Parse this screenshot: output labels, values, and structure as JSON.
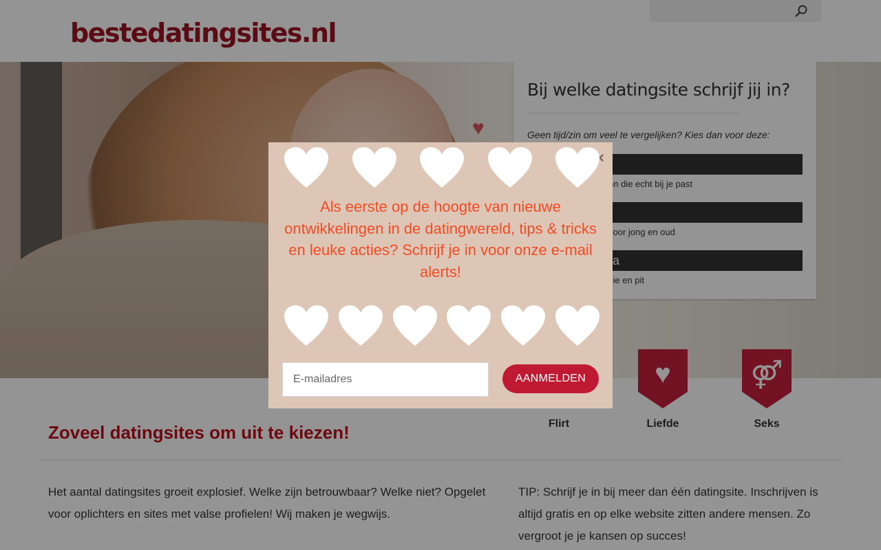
{
  "header": {
    "logo_text": "bestedatingsites.nl",
    "search_icon": "search-icon"
  },
  "panel": {
    "title": "Bij welke datingsite schrijf jij in?",
    "intro": "Geen tijd/zin om veel te vergelijken? Kies dan voor deze:",
    "sites": [
      {
        "name": "",
        "description": "on die echt bij je past"
      },
      {
        "name": "",
        "description": "voor jong en oud"
      },
      {
        "name": "ra",
        "description": "sie en pit"
      }
    ]
  },
  "categories": [
    {
      "label": "Flirt",
      "icon": "flirt-icon"
    },
    {
      "label": "Liefde",
      "icon": "heart-arrow-icon"
    },
    {
      "label": "Seks",
      "icon": "gender-symbols-icon"
    }
  ],
  "content": {
    "section_title": "Zoveel datingsites om uit te kiezen!",
    "left_text": "Het aantal datingsites groeit explosief. Welke zijn betrouwbaar? Welke niet? Opgelet voor oplichters en sites met valse profielen! Wij maken je wegwijs.",
    "right_text": "TIP: Schrijf je in bij meer dan één datingsite. Inschrijven is altijd gratis en op elke website zitten andere mensen. Zo vergroot je je kansen op succes!"
  },
  "modal": {
    "close_symbol": "×",
    "message": "Als eerste op de hoogte van nieuwe ontwikkelingen in de datingwereld, tips & tricks en leuke acties? Schrijf je in voor onze e-mail alerts!",
    "email_placeholder": "E-mailadres",
    "submit_label": "AANMELDEN",
    "heart_count_per_row": 5
  },
  "colors": {
    "brand_red": "#b80f1d",
    "modal_bg": "#ddc6b6",
    "modal_text": "#f24c25",
    "button_red": "#c01934"
  }
}
